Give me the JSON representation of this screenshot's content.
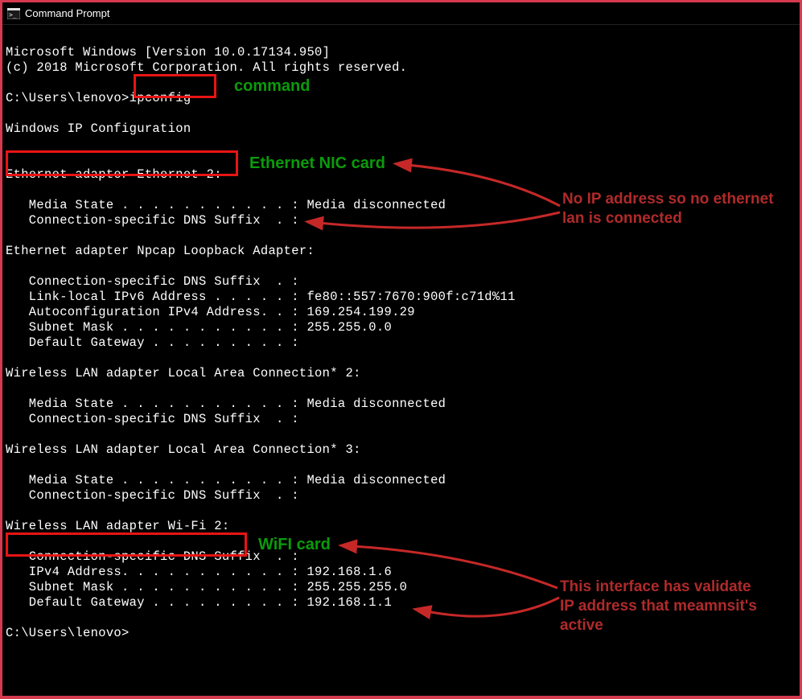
{
  "window": {
    "title": "Command Prompt"
  },
  "terminal": {
    "line1": "Microsoft Windows [Version 10.0.17134.950]",
    "line2": "(c) 2018 Microsoft Corporation. All rights reserved.",
    "prompt1": "C:\\Users\\lenovo>",
    "cmd": "ipconfig",
    "heading": "Windows IP Configuration",
    "adapter1": "Ethernet adapter Ethernet 2:",
    "a1_media": "   Media State . . . . . . . . . . . : Media disconnected",
    "a1_dns": "   Connection-specific DNS Suffix  . :",
    "adapter2": "Ethernet adapter Npcap Loopback Adapter:",
    "a2_dns": "   Connection-specific DNS Suffix  . :",
    "a2_ipv6": "   Link-local IPv6 Address . . . . . : fe80::557:7670:900f:c71d%11",
    "a2_auto": "   Autoconfiguration IPv4 Address. . : 169.254.199.29",
    "a2_mask": "   Subnet Mask . . . . . . . . . . . : 255.255.0.0",
    "a2_gw": "   Default Gateway . . . . . . . . . :",
    "adapter3": "Wireless LAN adapter Local Area Connection* 2:",
    "a3_media": "   Media State . . . . . . . . . . . : Media disconnected",
    "a3_dns": "   Connection-specific DNS Suffix  . :",
    "adapter4": "Wireless LAN adapter Local Area Connection* 3:",
    "a4_media": "   Media State . . . . . . . . . . . : Media disconnected",
    "a4_dns": "   Connection-specific DNS Suffix  . :",
    "adapter5": "Wireless LAN adapter Wi-Fi 2:",
    "a5_dns": "   Connection-specific DNS Suffix  . :",
    "a5_ipv4": "   IPv4 Address. . . . . . . . . . . : 192.168.1.6",
    "a5_mask": "   Subnet Mask . . . . . . . . . . . : 255.255.255.0",
    "a5_gw": "   Default Gateway . . . . . . . . . : 192.168.1.1",
    "prompt2": "C:\\Users\\lenovo>"
  },
  "annotations": {
    "command": "command",
    "ethernet_nic": "Ethernet NIC card",
    "no_ip": "No IP address so no ethernet lan is connected",
    "wifi_card": "WiFI card",
    "valid_ip": "This interface has validate IP address that meamnsit's active"
  }
}
